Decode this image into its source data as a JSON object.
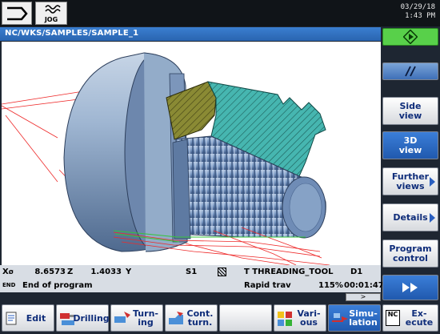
{
  "header": {
    "mode_label": "JOG",
    "date": "03/29/18",
    "time": "1:43 PM"
  },
  "path": "NC/WKS/SAMPLES/SAMPLE_1",
  "status": {
    "axis1_label": "X",
    "axis1_sub": "Ø",
    "axis1_value": "8.6573",
    "axis2_label": "Z",
    "axis2_value": "1.4033",
    "axis3_label": "Y",
    "spindle": "S1",
    "tool": "T THREADING_TOOL",
    "edge": "D1",
    "line_label": "END",
    "program_status": "End of program",
    "feed_mode": "Rapid trav",
    "override": "115%",
    "time": "00:01:47"
  },
  "vertical_softkeys": [
    {
      "label1": "",
      "label2": "",
      "icon": "cycle-start-icon"
    },
    {
      "label1": "",
      "label2": "",
      "icon": "double-slash-icon"
    },
    {
      "label1": "Side",
      "label2": "view"
    },
    {
      "label1": "3D",
      "label2": "view"
    },
    {
      "label1": "Further",
      "label2": "views"
    },
    {
      "label1": "Details",
      "label2": ""
    },
    {
      "label1": "Program",
      "label2": "control"
    },
    {
      "label1": "",
      "label2": "",
      "icon": "forward-icon"
    }
  ],
  "horizontal_softkeys": [
    {
      "label1": "Edit",
      "label2": ""
    },
    {
      "label1": "Drilling",
      "label2": ""
    },
    {
      "label1": "Turn-",
      "label2": "ing"
    },
    {
      "label1": "Cont.",
      "label2": "turn."
    },
    {
      "label1": "",
      "label2": ""
    },
    {
      "label1": "Vari-",
      "label2": "ous"
    },
    {
      "label1": "Simu-",
      "label2": "lation"
    },
    {
      "label1": "Ex-",
      "label2": "ecute",
      "icon_text": "NC"
    }
  ],
  "scroll_indicator": ">",
  "colors": {
    "active_key": "#2a64b0",
    "cycle_start": "#58d04a",
    "part_body": "#8fa9c8",
    "section_cyan": "#46b6b0",
    "section_olive": "#7e7e2c",
    "toolpath_red": "#ee2a2a",
    "toolpath_green": "#35c43a"
  }
}
